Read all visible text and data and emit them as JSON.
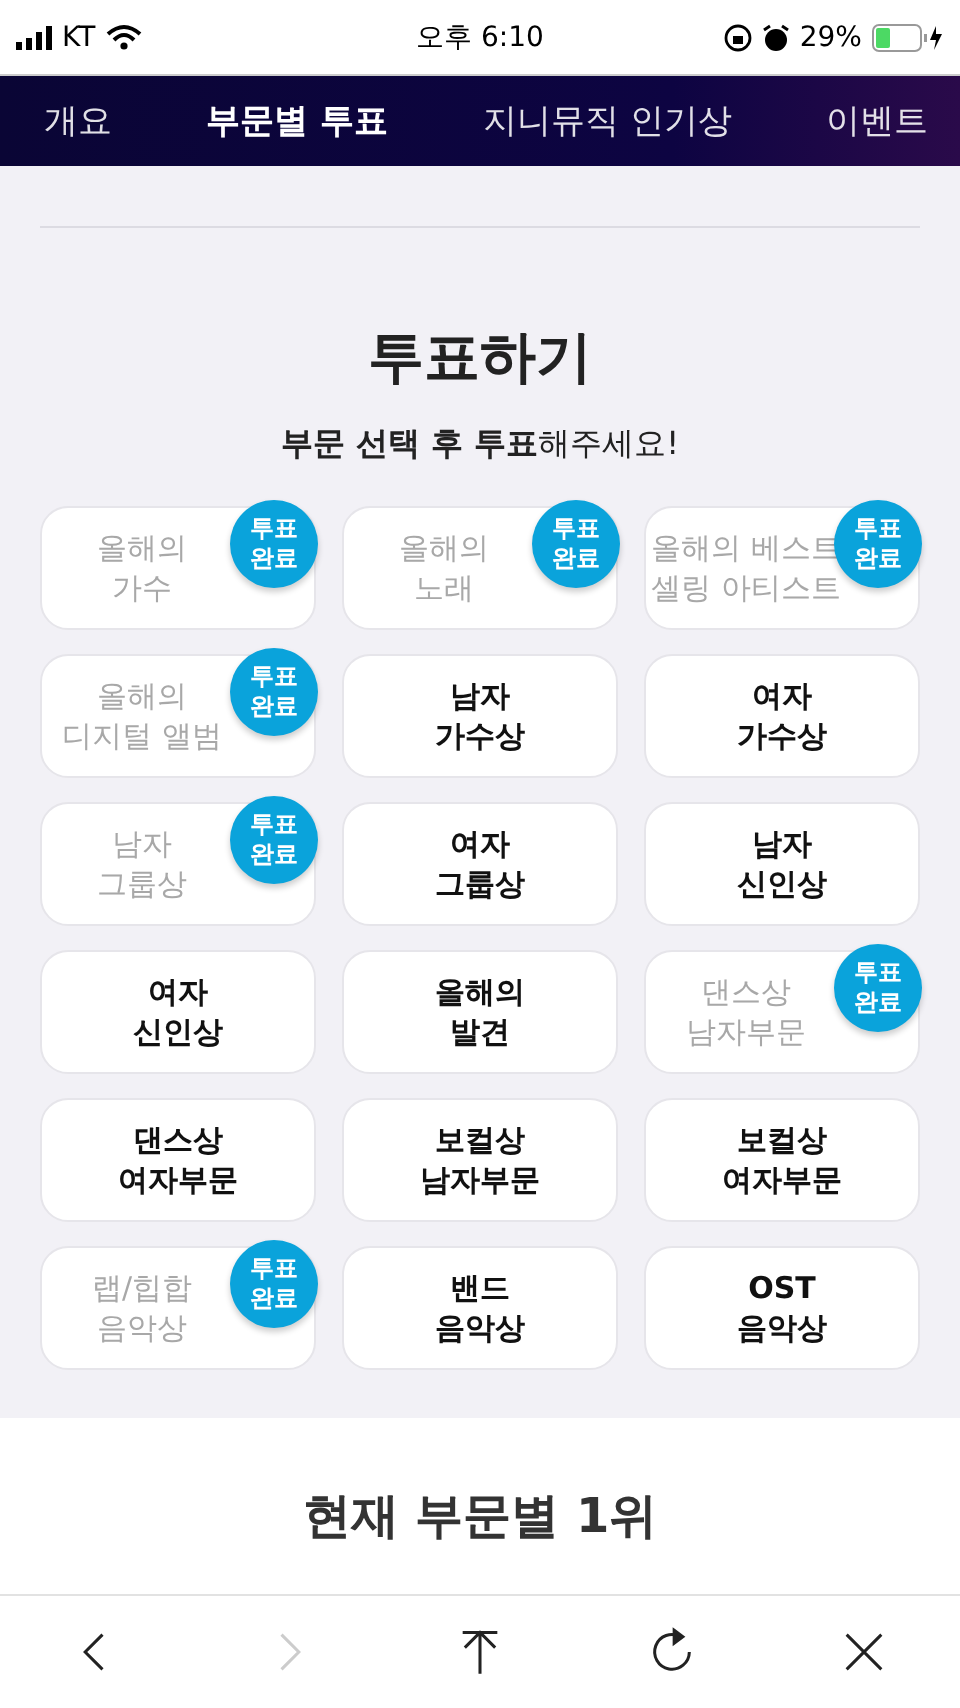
{
  "status_bar": {
    "carrier": "KT",
    "time": "오후 6:10",
    "battery": "29%"
  },
  "tabs": [
    {
      "label": "개요",
      "selected": false
    },
    {
      "label": "부문별 투표",
      "selected": true
    },
    {
      "label": "지니뮤직 인기상",
      "selected": false
    },
    {
      "label": "이벤트",
      "selected": false
    }
  ],
  "vote": {
    "title": "투표하기",
    "subtitle": "**부문 선택 후 투표**해주세요!",
    "categories": [
      {
        "lines": [
          "올해의",
          "가수"
        ],
        "voted": true,
        "badge": [
          "투표",
          "완료"
        ]
      },
      {
        "lines": [
          "올해의",
          "노래"
        ],
        "voted": true,
        "badge": [
          "투표",
          "완료"
        ]
      },
      {
        "lines": [
          "올해의 베스트",
          "셀링 아티스트"
        ],
        "voted": true,
        "badge": [
          "투표",
          "완료"
        ]
      },
      {
        "lines": [
          "올해의",
          "디지털 앨범"
        ],
        "voted": true,
        "badge": [
          "투표",
          "완료"
        ]
      },
      {
        "lines": [
          "남자",
          "가수상"
        ],
        "voted": false
      },
      {
        "lines": [
          "여자",
          "가수상"
        ],
        "voted": false
      },
      {
        "lines": [
          "남자",
          "그룹상"
        ],
        "voted": true,
        "badge": [
          "투표",
          "완료"
        ]
      },
      {
        "lines": [
          "여자",
          "그룹상"
        ],
        "voted": false
      },
      {
        "lines": [
          "남자",
          "신인상"
        ],
        "voted": false
      },
      {
        "lines": [
          "여자",
          "신인상"
        ],
        "voted": false
      },
      {
        "lines": [
          "올해의",
          "발견"
        ],
        "voted": false
      },
      {
        "lines": [
          "댄스상",
          "남자부문"
        ],
        "voted": true,
        "badge": [
          "투표",
          "완료"
        ]
      },
      {
        "lines": [
          "댄스상",
          "여자부문"
        ],
        "voted": false
      },
      {
        "lines": [
          "보컬상",
          "남자부문"
        ],
        "voted": false
      },
      {
        "lines": [
          "보컬상",
          "여자부문"
        ],
        "voted": false
      },
      {
        "lines": [
          "랩/힙합",
          "음악상"
        ],
        "voted": true,
        "badge": [
          "투표",
          "완료"
        ]
      },
      {
        "lines": [
          "밴드",
          "음악상"
        ],
        "voted": false
      },
      {
        "lines": [
          "OST",
          "음악상"
        ],
        "voted": false
      }
    ]
  },
  "winners": {
    "title": "현재 부문별 1위"
  },
  "toolbar": [
    {
      "kind": "back",
      "disabled": false
    },
    {
      "kind": "forward",
      "disabled": true
    },
    {
      "kind": "top",
      "disabled": false
    },
    {
      "kind": "reload",
      "disabled": false
    },
    {
      "kind": "close",
      "disabled": false
    }
  ]
}
